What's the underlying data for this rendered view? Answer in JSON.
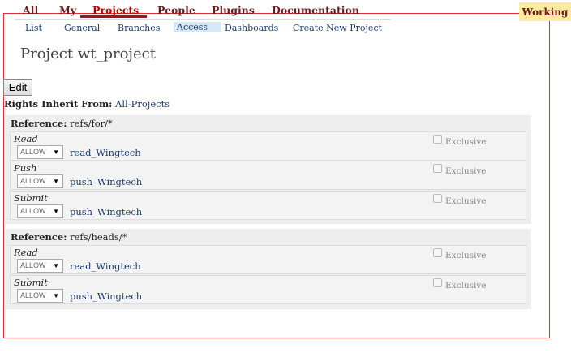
{
  "topnav": {
    "items": [
      "All",
      "My",
      "Projects",
      "People",
      "Plugins",
      "Documentation"
    ],
    "active": "Projects"
  },
  "status": {
    "label": "Working"
  },
  "subnav": {
    "items": [
      "List",
      "General",
      "Branches",
      "Access",
      "Dashboards",
      "Create New Project"
    ],
    "active": "Access"
  },
  "page": {
    "title": "Project wt_project",
    "edit_label": "Edit",
    "inherit_label": "Rights Inherit From:",
    "inherit_value": "All-Projects"
  },
  "sections": [
    {
      "ref_label": "Reference:",
      "ref_value": "refs/for/*",
      "permissions": [
        {
          "name": "Read",
          "action": "ALLOW",
          "group": "read_Wingtech",
          "exclusive_label": "Exclusive"
        },
        {
          "name": "Push",
          "action": "ALLOW",
          "group": "push_Wingtech",
          "exclusive_label": "Exclusive"
        },
        {
          "name": "Submit",
          "action": "ALLOW",
          "group": "push_Wingtech",
          "exclusive_label": "Exclusive"
        }
      ]
    },
    {
      "ref_label": "Reference:",
      "ref_value": "refs/heads/*",
      "permissions": [
        {
          "name": "Read",
          "action": "ALLOW",
          "group": "read_Wingtech",
          "exclusive_label": "Exclusive"
        },
        {
          "name": "Submit",
          "action": "ALLOW",
          "group": "push_Wingtech",
          "exclusive_label": "Exclusive"
        }
      ]
    }
  ]
}
